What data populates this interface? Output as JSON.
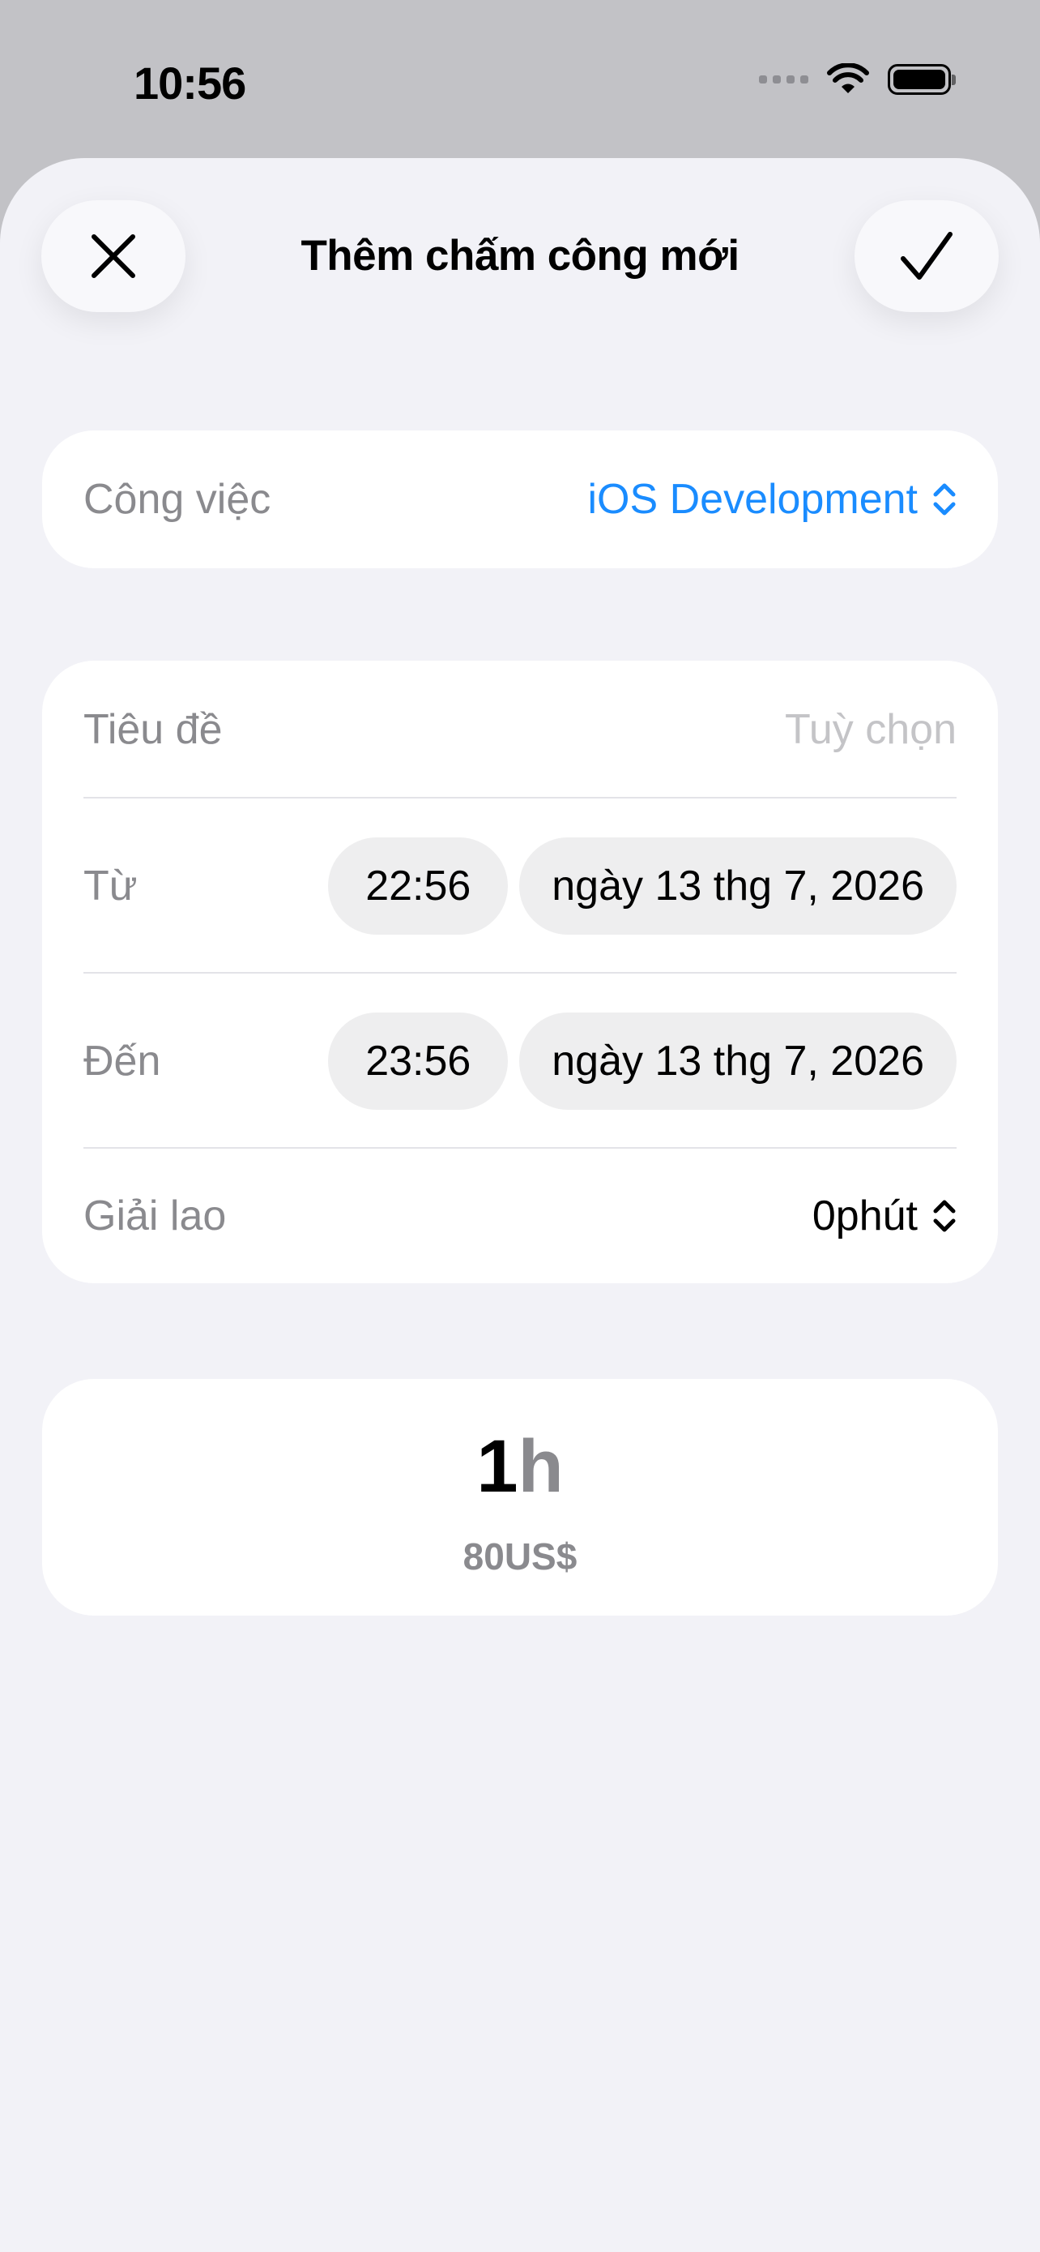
{
  "status_bar": {
    "time": "10:56"
  },
  "header": {
    "title": "Thêm chấm công mới",
    "close_icon": "close-icon",
    "confirm_icon": "checkmark-icon"
  },
  "job": {
    "label": "Công việc",
    "value": "iOS Development",
    "accent_color": "#1a8cff"
  },
  "fields": {
    "title_label": "Tiêu đề",
    "title_placeholder": "Tuỳ chọn",
    "from_label": "Từ",
    "from_time": "22:56",
    "from_date": "ngày 13 thg 7, 2026",
    "to_label": "Đến",
    "to_time": "23:56",
    "to_date": "ngày 13 thg 7, 2026",
    "break_label": "Giải lao",
    "break_value": "0phút"
  },
  "summary": {
    "hours_value": "1",
    "hours_unit": "h",
    "amount": "80US$"
  }
}
